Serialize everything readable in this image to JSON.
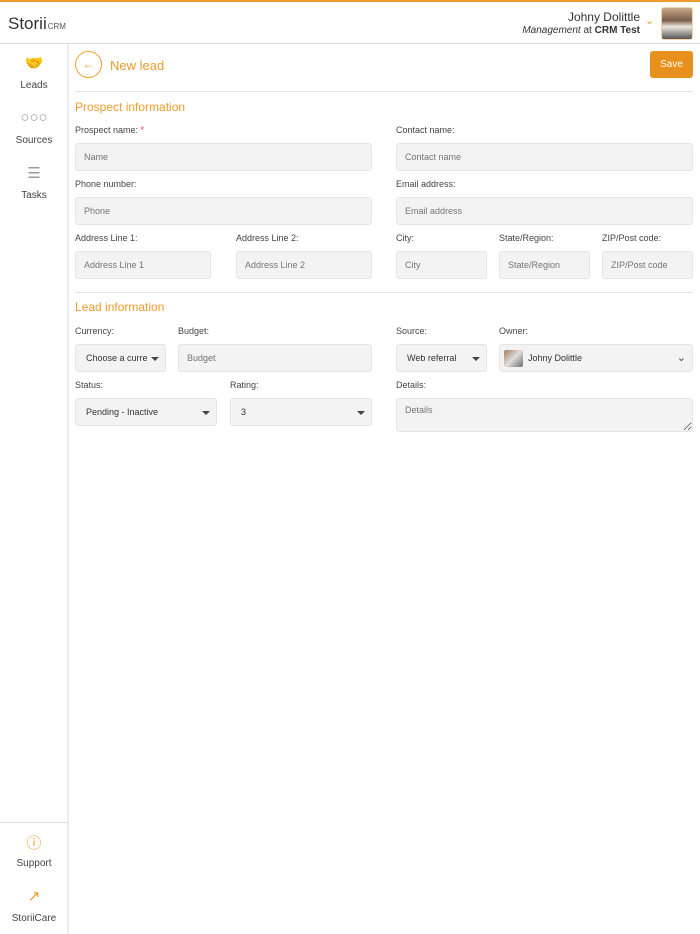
{
  "header": {
    "logo": "Storii",
    "logo_suffix": "CRM",
    "user_name": "Johny Dolittle",
    "user_role": "Management",
    "user_at": "at",
    "user_org": "CRM Test"
  },
  "sidebar": {
    "items": [
      {
        "label": "Leads",
        "icon": "handshake-icon"
      },
      {
        "label": "Sources",
        "icon": "sources-icon"
      },
      {
        "label": "Tasks",
        "icon": "tasks-icon"
      }
    ],
    "bottom": [
      {
        "label": "Support",
        "icon": "help-circle-icon"
      },
      {
        "label": "StoriiCare",
        "icon": "external-link-icon"
      }
    ]
  },
  "page": {
    "title": "New lead",
    "save_label": "Save"
  },
  "prospect": {
    "title": "Prospect information",
    "name_label": "Prospect name:",
    "required": "*",
    "name_ph": "Name",
    "contact_label": "Contact name:",
    "contact_ph": "Contact name",
    "phone_label": "Phone number:",
    "phone_ph": "Phone",
    "email_label": "Email address:",
    "email_ph": "Email address",
    "addr1_label": "Address Line 1:",
    "addr1_ph": "Address Line 1",
    "addr2_label": "Address Line 2:",
    "addr2_ph": "Address Line 2",
    "city_label": "City:",
    "city_ph": "City",
    "state_label": "State/Region:",
    "state_ph": "State/Region",
    "zip_label": "ZIP/Post code:",
    "zip_ph": "ZIP/Post code"
  },
  "lead": {
    "title": "Lead information",
    "currency_label": "Currency:",
    "currency_value": "Choose a curre",
    "budget_label": "Budget:",
    "budget_ph": "Budget",
    "source_label": "Source:",
    "source_value": "Web referral",
    "owner_label": "Owner:",
    "owner_value": "Johny Dolittle",
    "status_label": "Status:",
    "status_value": "Pending - Inactive",
    "rating_label": "Rating:",
    "rating_value": "3",
    "details_label": "Details:",
    "details_ph": "Details"
  },
  "colors": {
    "accent": "#ee9b2c",
    "save": "#e8901c"
  }
}
